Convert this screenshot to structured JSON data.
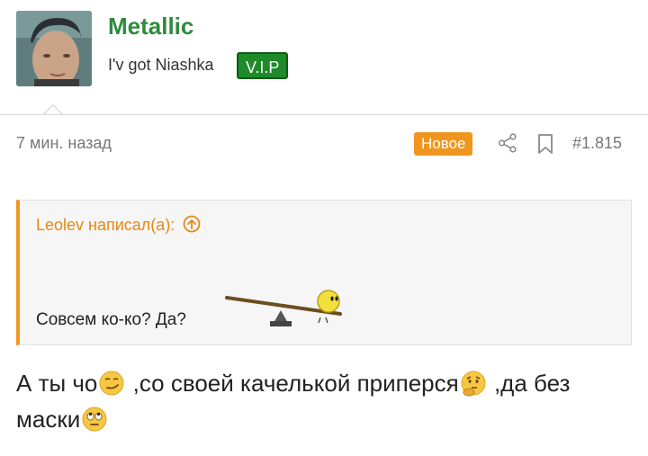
{
  "user": {
    "name": "Metallic",
    "title": "I'v got Niashka",
    "badge": "V.I.P"
  },
  "post": {
    "time": "7 мин. назад",
    "new_label": "Новое",
    "number": "#1.815",
    "quote": {
      "author_line": "Leolev написал(а):",
      "text": "Совсем ко-ко? Да?"
    },
    "body": {
      "part1": "А ты чо",
      "part2": " ,со своей качелькой приперся",
      "part3": " ,да без маски"
    }
  },
  "icons": [
    "share-icon",
    "bookmark-icon",
    "arrow-up-circle-icon",
    "smirk-emoji-icon",
    "thinking-emoji-icon",
    "eye-roll-emoji-icon"
  ],
  "colors": {
    "username": "#2f8a3c",
    "vip_badge": "#1f8a2a",
    "accent_orange": "#f0961e",
    "quote_link": "#e8870f"
  }
}
